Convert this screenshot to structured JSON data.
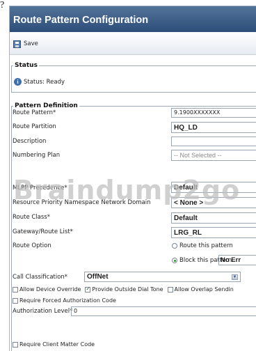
{
  "corner_mark": "?",
  "header": {
    "title": "Route Pattern Configuration"
  },
  "toolbar": {
    "save_label": "Save"
  },
  "status": {
    "legend": "Status",
    "text": "Status: Ready"
  },
  "pattern_definition": {
    "legend": "Pattern Definition",
    "route_pattern": {
      "label": "Route Pattern*",
      "value": "9.1900XXXXXXX"
    },
    "route_partition": {
      "label": "Route Partition",
      "value": "HQ_LD"
    },
    "description": {
      "label": "Description",
      "value": ""
    },
    "numbering_plan": {
      "label": "Numbering Plan",
      "value": "-- Not Selected --"
    },
    "mlpp_precedence": {
      "label": "MLPP Precedence*",
      "value": "Default"
    },
    "resource_priority": {
      "label": "Resource Priority Namespace Network Domain",
      "value": "< None >"
    },
    "route_class": {
      "label": "Route Class*",
      "value": "Default"
    },
    "gateway_route_list": {
      "label": "Gateway/Route List*",
      "value": "LRG_RL"
    },
    "route_option": {
      "label": "Route Option",
      "route_label": "Route this pattern",
      "block_label": "Block this pattern",
      "selected": "block",
      "block_reason": "No Err"
    },
    "call_classification": {
      "label": "Call Classification*",
      "value": "OffNet"
    },
    "checkboxes": {
      "allow_device_override": {
        "label": "Allow Device Override",
        "checked": false
      },
      "provide_outside_dial_tone": {
        "label": "Provide Outside Dial Tone",
        "checked": true
      },
      "allow_overlap_sending": {
        "label": "Allow Overlap Sendin",
        "checked": false
      },
      "require_forced_auth": {
        "label": "Require Forced Authorization Code",
        "checked": false
      },
      "require_client_matter": {
        "label": "Require Client Matter Code",
        "checked": false
      }
    },
    "authorization_level": {
      "label": "Authorization Level*",
      "value": "0"
    }
  },
  "watermark": "Braindump2go"
}
